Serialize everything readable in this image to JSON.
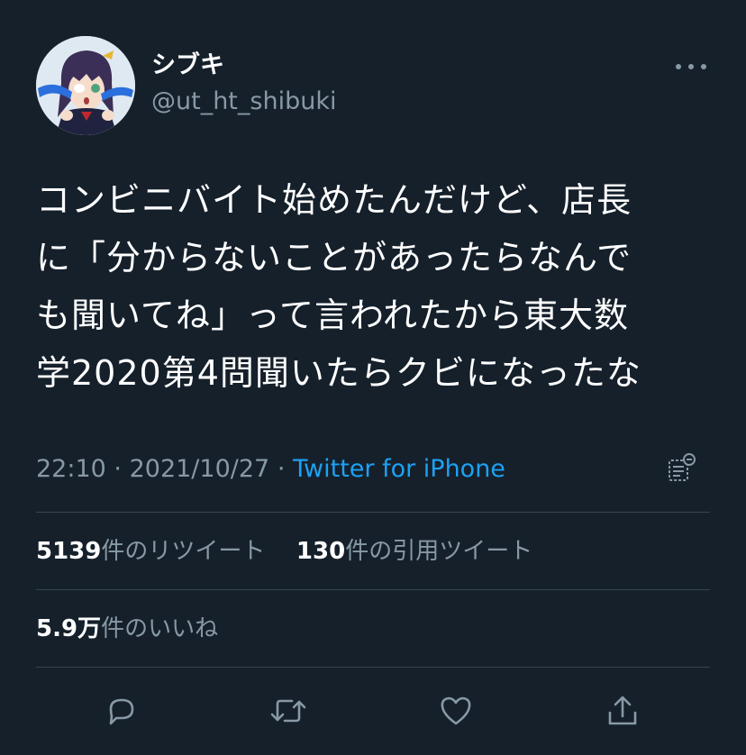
{
  "user": {
    "display_name": "シブキ",
    "handle": "@ut_ht_shibuki"
  },
  "tweet": {
    "lines": [
      "コンビニバイト始めたんだけど、店長",
      "に「分からないことがあったらなんで",
      "も聞いてね」って言われたから東大数",
      "学2020第4問聞いたらクビになったな"
    ]
  },
  "meta": {
    "time": "22:10",
    "separator": "·",
    "date": "2021/10/27",
    "source": "Twitter for iPhone"
  },
  "stats": {
    "retweets_count": "5139",
    "retweets_label": "件のリツイート",
    "quotes_count": "130",
    "quotes_label": "件の引用ツイート",
    "likes_count": "5.9万",
    "likes_label": "件のいいね"
  },
  "colors": {
    "background": "#15202b",
    "text": "#ffffff",
    "secondary": "#8899a6",
    "accent": "#1da1f2",
    "divider": "#38444d"
  },
  "icons": [
    "more-icon",
    "analytics-icon",
    "reply-icon",
    "retweet-icon",
    "like-icon",
    "share-icon"
  ]
}
